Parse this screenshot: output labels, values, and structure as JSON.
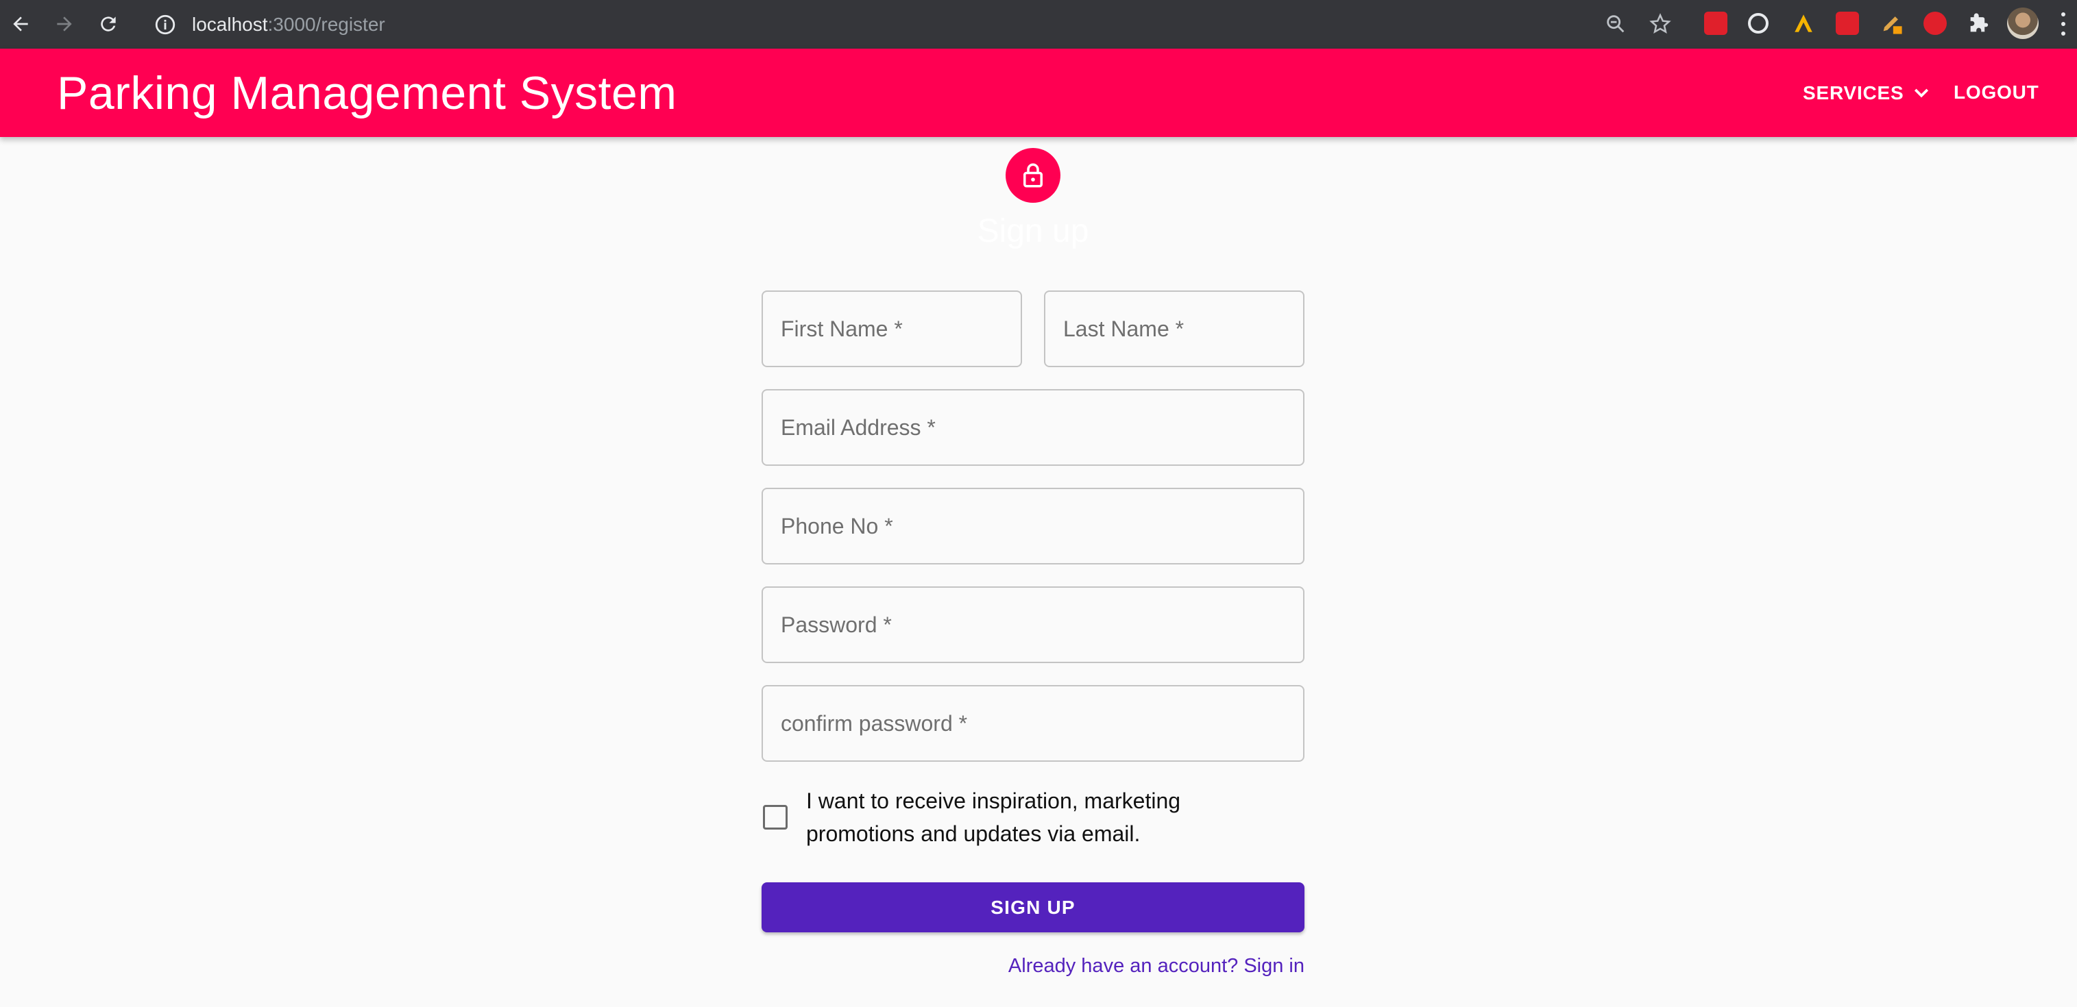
{
  "browser": {
    "url_host": "localhost",
    "url_path": ":3000/register",
    "extensions": [
      "youtube-ext-icon",
      "github-ext-icon",
      "acrobat-ext-icon",
      "raindrop-ext-icon",
      "pen-ext-icon",
      "adblock-ext-icon",
      "puzzle-icon"
    ]
  },
  "appbar": {
    "title": "Parking Management System",
    "services_label": "SERVICES",
    "logout_label": "LOGOUT",
    "color": "#ff0052"
  },
  "form": {
    "heading": "Sign up",
    "first_name_label": "First Name *",
    "last_name_label": "Last Name *",
    "email_label": "Email Address *",
    "phone_label": "Phone No *",
    "password_label": "Password *",
    "confirm_password_label": "confirm password *",
    "checkbox_label": "I want to receive inspiration, marketing promotions and updates via email.",
    "submit_label": "SIGN UP",
    "signin_link": "Already have an account? Sign in",
    "accent_color": "#5422bd"
  }
}
